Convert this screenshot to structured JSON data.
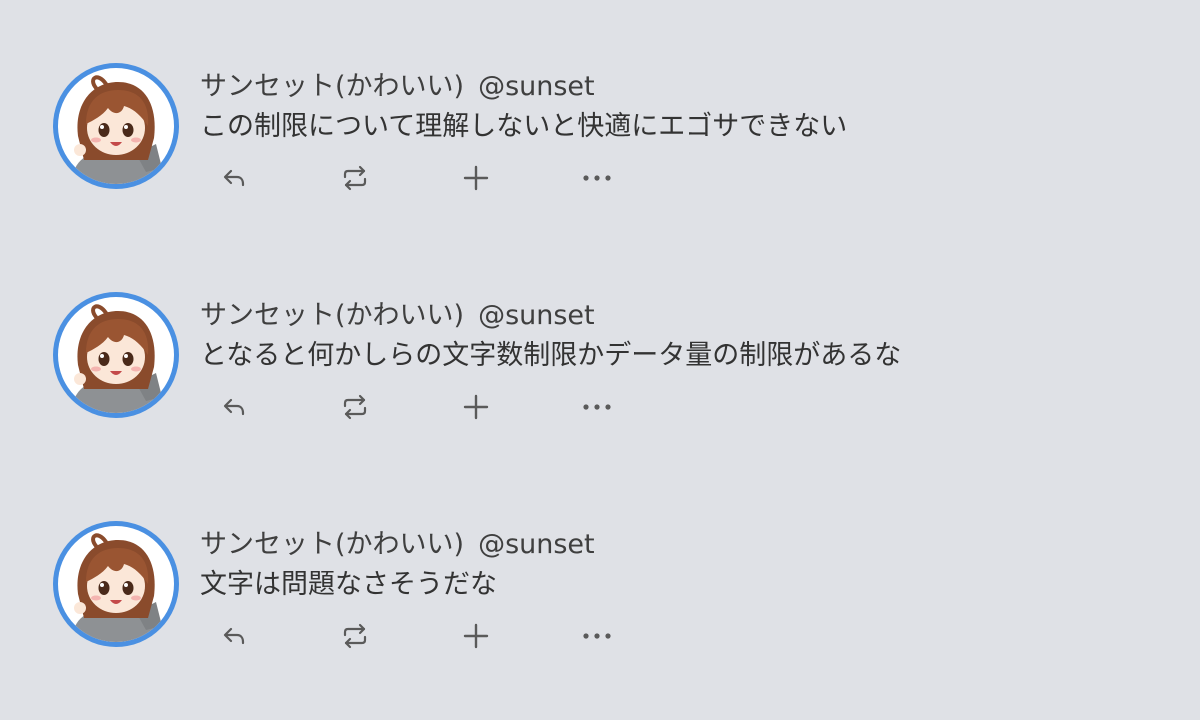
{
  "posts": [
    {
      "display_name": "サンセット(かわいい)",
      "handle": "@sunset",
      "text": "この制限について理解しないと快適にエゴサできない",
      "avatar_icon": "anime-girl-avatar"
    },
    {
      "display_name": "サンセット(かわいい)",
      "handle": "@sunset",
      "text": "となると何かしらの文字数制限かデータ量の制限があるな",
      "avatar_icon": "anime-girl-avatar"
    },
    {
      "display_name": "サンセット(かわいい)",
      "handle": "@sunset",
      "text": "文字は問題なさそうだな",
      "avatar_icon": "anime-girl-avatar"
    }
  ],
  "actions": {
    "reply_icon": "reply-icon",
    "repost_icon": "repost-icon",
    "add_icon": "plus-icon",
    "more_icon": "more-icon"
  },
  "colors": {
    "background": "#dfe1e6",
    "avatar_ring": "#4a90e2",
    "text": "#333333",
    "icon": "#5a5a5a"
  }
}
